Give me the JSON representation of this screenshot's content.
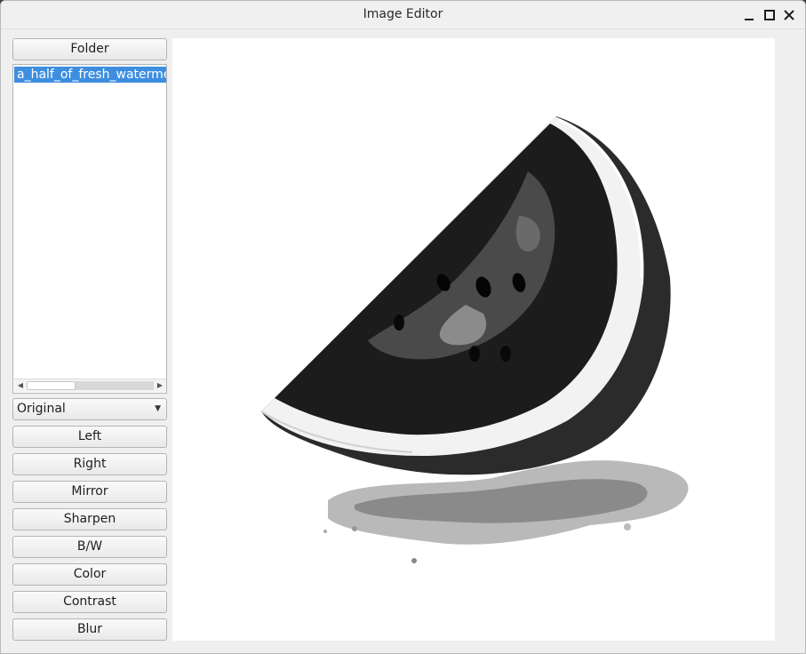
{
  "window": {
    "title": "Image Editor"
  },
  "sidebar": {
    "folder_label": "Folder",
    "files": [
      "a_half_of_fresh_watermelon"
    ],
    "filter": {
      "selected": "Original"
    },
    "buttons": {
      "left": "Left",
      "right": "Right",
      "mirror": "Mirror",
      "sharpen": "Sharpen",
      "bw": "B/W",
      "color": "Color",
      "contrast": "Contrast",
      "blur": "Blur"
    }
  },
  "icons": {
    "minimize": "minimize-icon",
    "maximize": "maximize-icon",
    "close": "close-icon",
    "scroll_left": "chevron-left-icon",
    "scroll_right": "chevron-right-icon",
    "dropdown": "chevron-down-icon"
  },
  "colors": {
    "selection": "#3d8ee0",
    "canvas": "#ffffff"
  }
}
